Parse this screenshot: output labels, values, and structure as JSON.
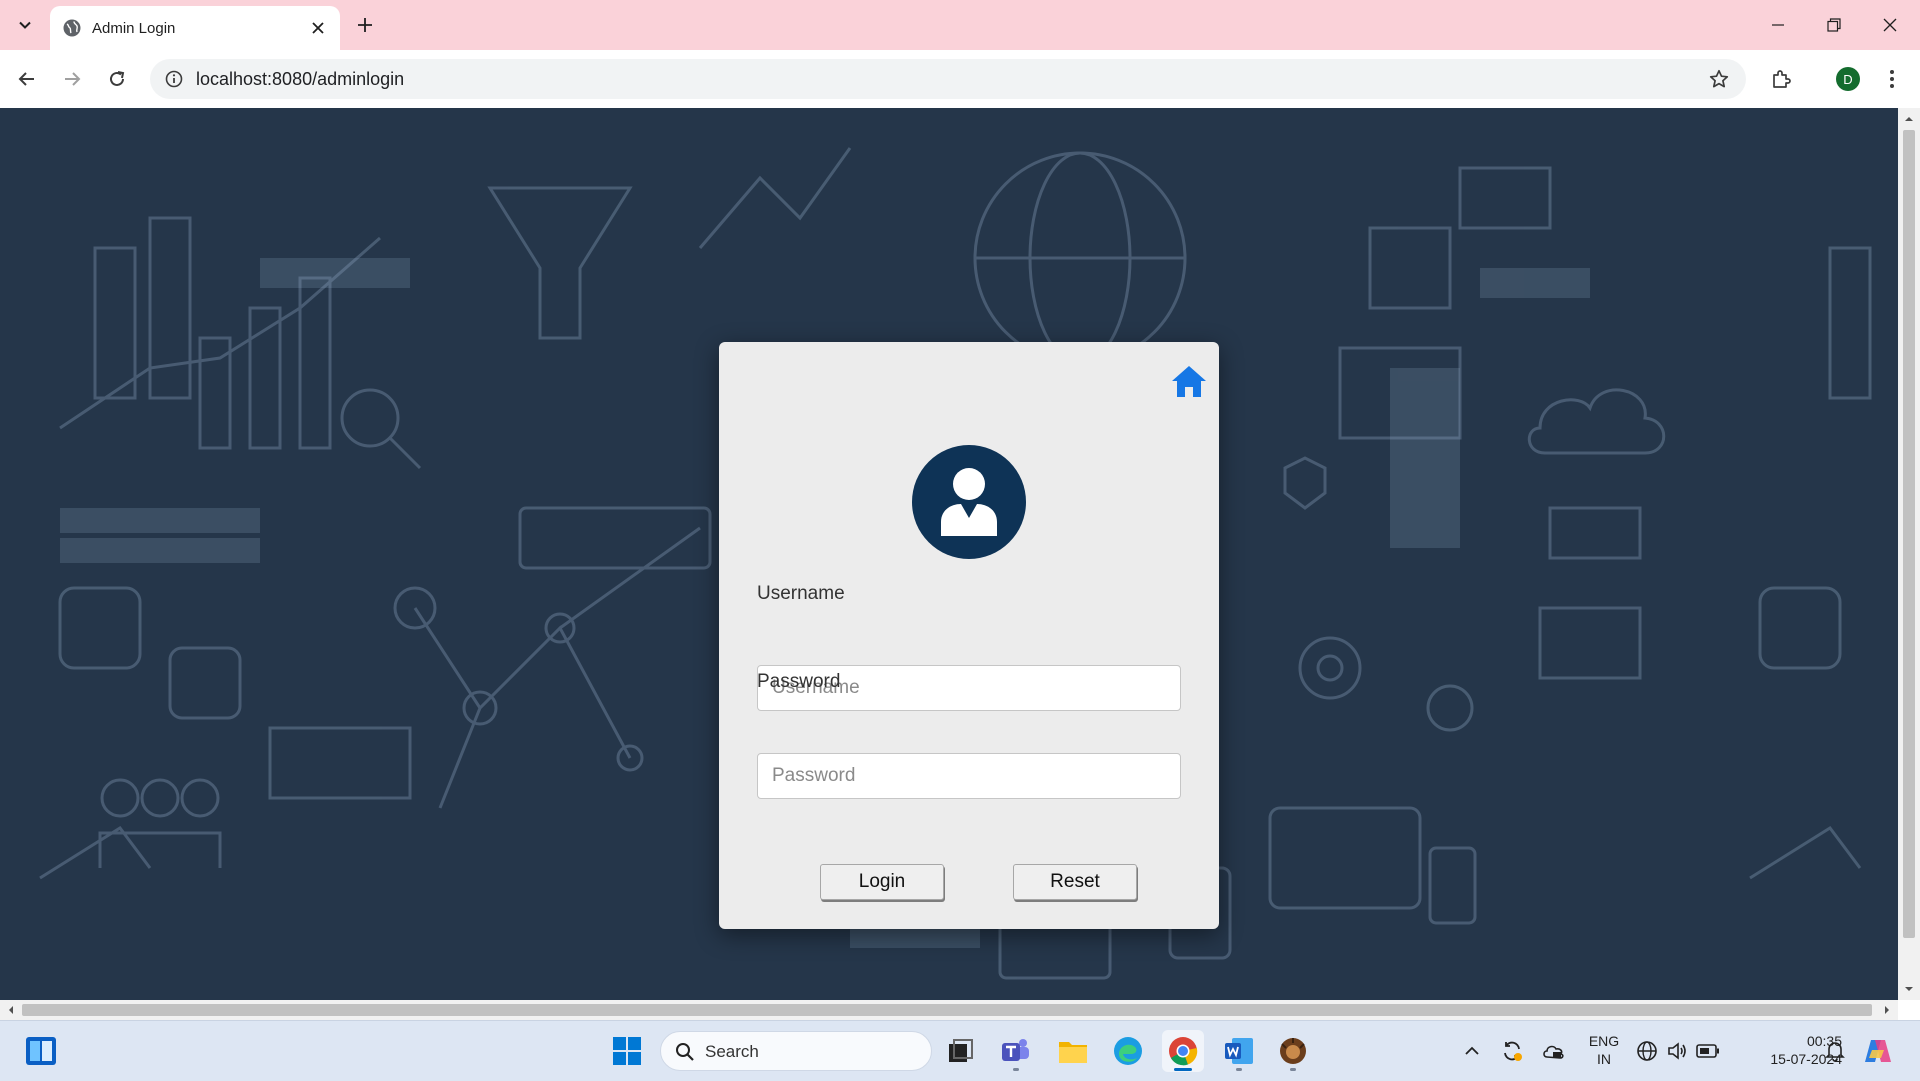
{
  "browser": {
    "tab_title": "Admin Login",
    "url": "localhost:8080/adminlogin",
    "profile_initial": "D"
  },
  "login": {
    "username_label": "Username",
    "username_placeholder": "Username",
    "username_value": "",
    "password_label": "Password",
    "password_placeholder": "Password",
    "password_value": "",
    "login_button": "Login",
    "reset_button": "Reset"
  },
  "taskbar": {
    "search_placeholder": "Search",
    "lang_line1": "ENG",
    "lang_line2": "IN",
    "time": "00:35",
    "date": "15-07-2024"
  },
  "colors": {
    "tabstrip": "#fad2d9",
    "page_background": "#25364a",
    "card": "#ececec",
    "avatar": "#0e3356",
    "home_icon": "#1677e5",
    "taskbar": "#dde6f3"
  },
  "icons": [
    "tab-search-icon",
    "globe-icon",
    "close-icon",
    "plus-icon",
    "minimize-icon",
    "restore-icon",
    "back-arrow-icon",
    "forward-arrow-icon",
    "reload-icon",
    "site-info-icon",
    "star-icon",
    "extensions-icon",
    "kebab-menu-icon",
    "home-icon",
    "user-icon",
    "windows-start-icon",
    "search-icon",
    "task-view-icon",
    "teams-icon",
    "file-explorer-icon",
    "edge-icon",
    "chrome-icon",
    "word-icon",
    "app-icon",
    "chevron-up-icon",
    "sync-icon",
    "cloud-icon",
    "network-icon",
    "volume-icon",
    "battery-icon",
    "bell-icon",
    "copilot-icon"
  ]
}
